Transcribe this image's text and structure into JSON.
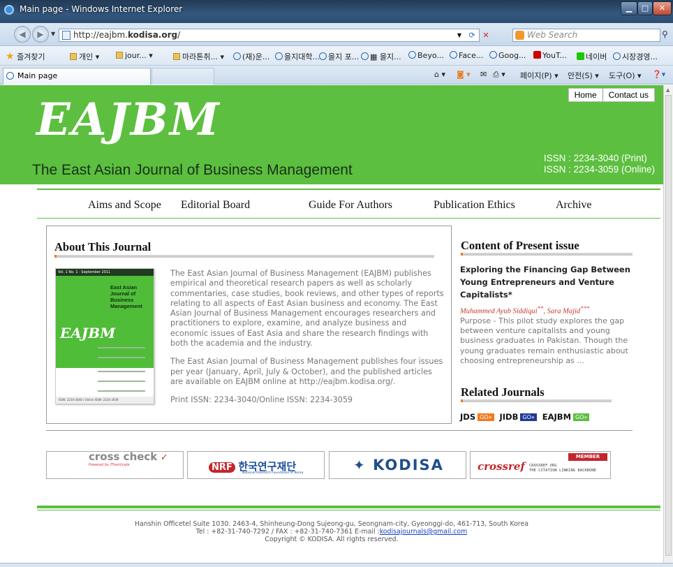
{
  "browser": {
    "window_title": "Main page - Windows Internet Explorer",
    "url_plain": "http://eajbm.",
    "url_bold": "kodisa.org",
    "url_tail": "/",
    "search_placeholder": "Web Search",
    "tab_label": "Main page",
    "favorites_label": "즐겨찾기",
    "favorites": [
      "개인 ▾",
      "jour... ▾",
      "마라톤취... ▾",
      "(재)운...",
      "을지대학...",
      "을지 포...",
      "▦ 을지...",
      "Beyo...",
      "Face...",
      "Goog...",
      "YouT...",
      "네이버",
      "시장경영..."
    ],
    "command_bar": {
      "page": "페이지(P) ▾",
      "safety": "안전(S) ▾",
      "tools": "도구(O) ▾"
    }
  },
  "site": {
    "logo": "EAJBM",
    "subtitle": "The East Asian Journal of Business Management",
    "issn_print": "ISSN : 2234-3040 (Print)",
    "issn_online": "ISSN : 2234-3059 (Online)",
    "top_nav": {
      "home": "Home",
      "contact": "Contact us"
    },
    "main_nav": [
      "Aims and Scope",
      "Editorial Board",
      "Guide For Authors",
      "Publication Ethics",
      "Archive"
    ]
  },
  "about": {
    "heading": "About This Journal",
    "paragraph1": "The East Asian Journal of Business Management (EAJBM) publishes empirical and theoretical research papers as well as scholarly commentaries, case studies, book reviews, and other types of reports relating to all aspects of East Asian business and economy. The East Asian Journal of Business Management encourages researchers and practitioners to explore, examine, and analyze business and economic issues of East Asia and share the research findings with both the academia and the industry.",
    "paragraph2": "The East Asian Journal of Business Management publishes four issues per year (January, April, July & October), and the published articles are available on EAJBM online at http://eajbm.kodisa.org/.",
    "issn_line": "Print ISSN: 2234-3040/Online ISSN: 2234-3059",
    "cover": {
      "top_text": "Vol. 1 No. 1 · September 2011",
      "name_line1": "East Asian",
      "name_line2": "Journal of",
      "name_line3": "Business",
      "name_line4": "Management",
      "logo": "EAJBM",
      "footer_text": "ISSN: 2234-3040 / Online ISSN: 2234-3059"
    }
  },
  "present_issue": {
    "heading": "Content of Present issue",
    "article_title": "Exploring the Financing Gap Between Young Entrepreneurs and Venture Capitalists*",
    "author1": "Muhammed Ayub Siddiqui",
    "author1_mark": "**",
    "author_sep": ", ",
    "author2": "Sara Majid",
    "author2_mark": "***",
    "abstract": "Purpose - This pilot study explores the gap between venture capitalists and young business graduates in Pakistan. Though the young graduates remain enthusiastic about choosing entrepreneurship as ..."
  },
  "related": {
    "heading": "Related Journals",
    "journals": [
      {
        "name": "JDS",
        "go": "GO»",
        "color": "#f07a1e"
      },
      {
        "name": "JIDB",
        "go": "GO»",
        "color": "#1f3a9a"
      },
      {
        "name": "EAJBM",
        "go": "GO»",
        "color": "#5cbf3f"
      }
    ]
  },
  "partners": {
    "crosscheck": "cross check",
    "crosscheck_powered": "Powered by iThenticate",
    "nrf": "NRF",
    "nrf_korean": "한국연구재단",
    "nrf_english": "National Research Foundation of Korea",
    "kodisa": "KODISA",
    "crossref": "crossref",
    "crossref_member": "MEMBER",
    "crossref_org": "CROSSREF.ORG",
    "crossref_tagline": "THE CITATION LINKING BACKBONE"
  },
  "footer": {
    "address": "Hanshin Officetel Suite 1030. 2463-4, Shinheung-Dong Sujeong-gu, Seongnam-city, Gyeonggi-do, 461-713, South Korea",
    "phone_fax": "Tel : +82-31-740-7292 / FAX : +82-31-740-7361 E-mail :",
    "email": "kodisajournals@gmail.com",
    "copyright": "Copyright © KODISA. All rights reserved."
  }
}
